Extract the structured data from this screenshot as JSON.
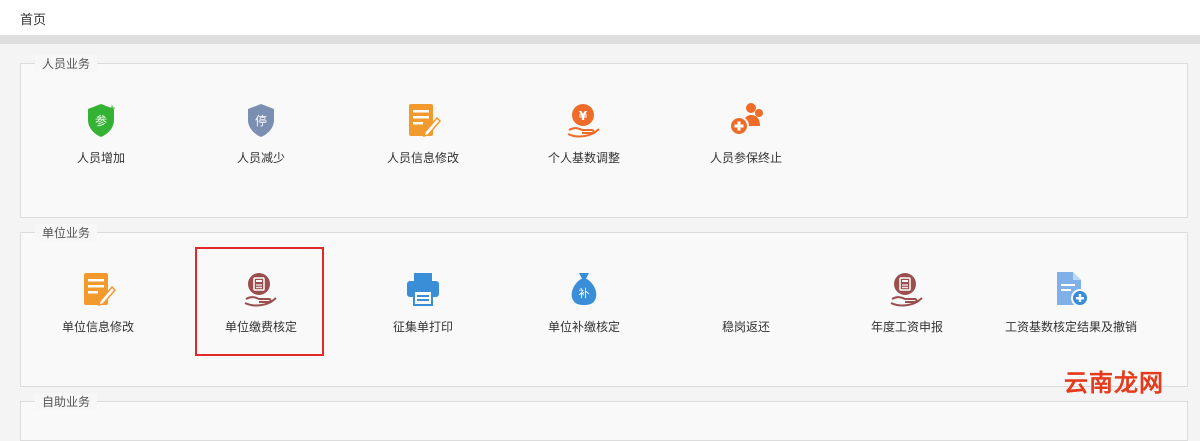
{
  "breadcrumb": "首页",
  "sections": [
    {
      "title": "人员业务",
      "items": [
        {
          "label": "人员增加",
          "icon": "shield-plus-icon"
        },
        {
          "label": "人员减少",
          "icon": "shield-stop-icon"
        },
        {
          "label": "人员信息修改",
          "icon": "edit-document-icon"
        },
        {
          "label": "个人基数调整",
          "icon": "yen-hand-icon"
        },
        {
          "label": "人员参保终止",
          "icon": "people-add-icon"
        }
      ]
    },
    {
      "title": "单位业务",
      "items": [
        {
          "label": "单位信息修改",
          "icon": "edit-document-icon"
        },
        {
          "label": "单位缴费核定",
          "icon": "calculator-hand-icon"
        },
        {
          "label": "征集单打印",
          "icon": "printer-icon"
        },
        {
          "label": "单位补缴核定",
          "icon": "money-bag-icon"
        },
        {
          "label": "稳岗返还",
          "icon": "blank-icon"
        },
        {
          "label": "年度工资申报",
          "icon": "calculator-hand-icon"
        },
        {
          "label": "工资基数核定结果及撤销",
          "icon": "document-add-icon"
        }
      ]
    },
    {
      "title": "自助业务"
    }
  ],
  "icon_glyphs": {
    "insure": "参",
    "stop": "停",
    "yen": "¥",
    "supplement": "补"
  },
  "colors": {
    "green": "#34b233",
    "slate": "#7b8fb3",
    "orange": "#f29a2e",
    "red_orange": "#ee6b2a",
    "maroon": "#9b4e4e",
    "blue": "#3a8ed8",
    "highlight": "#e02a2a"
  },
  "watermark": "云南龙网"
}
